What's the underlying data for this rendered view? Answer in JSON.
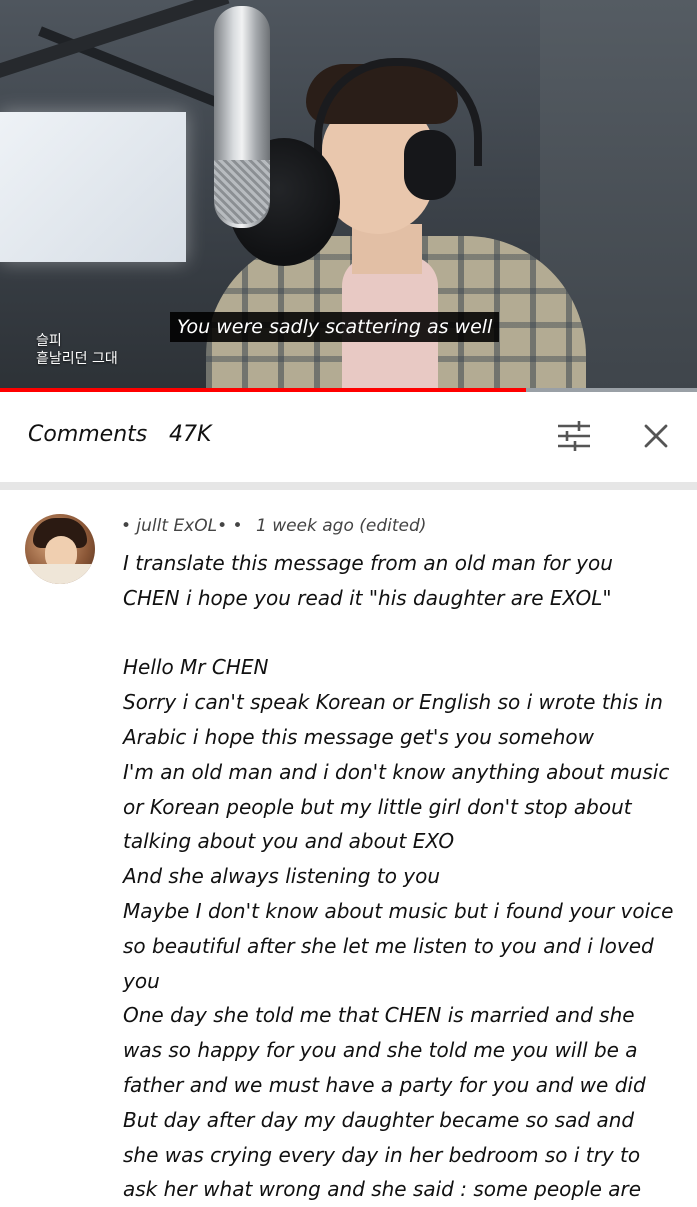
{
  "video": {
    "caption": "You were sadly scattering as well",
    "overlay_line1": "슬피",
    "overlay_line2": "흩날리던 그대",
    "progress_fraction": 0.755
  },
  "comments_panel": {
    "title": "Comments",
    "count": "47K",
    "filter_icon": "sliders-icon",
    "close_icon": "close-icon"
  },
  "comment": {
    "author": "• jullt ExOL• •",
    "time": "1 week ago (edited)",
    "lines": [
      "I translate this message from an old man for you",
      "CHEN i hope you read it \"his daughter are EXOL\"",
      "",
      "Hello Mr CHEN",
      "Sorry i can't speak Korean or English so i wrote this in",
      "Arabic i hope this message get's you somehow",
      "I'm an old man and i don't know anything about music",
      "or Korean people but my little girl don't stop about",
      "talking about you and about EXO",
      "And she always listening to you",
      "Maybe I don't know about music but i found your voice",
      "so beautiful after she let me listen to you and i loved",
      "you",
      "One day she told me that CHEN is married and she",
      "was so happy for you and she told me you will be a",
      "father and we must have a party for you and we did",
      "But day after day my daughter became so sad and",
      "she was crying every day in her bedroom so i try to",
      "ask her what wrong and she said : some people are"
    ]
  }
}
